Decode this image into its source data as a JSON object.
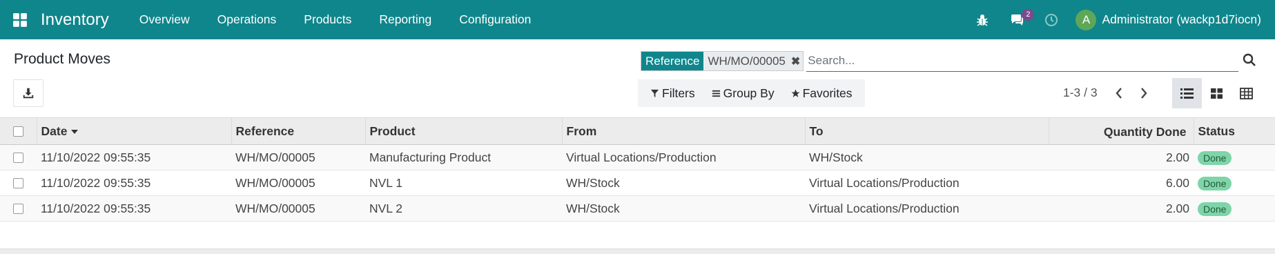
{
  "navbar": {
    "brand": "Inventory",
    "menu": [
      "Overview",
      "Operations",
      "Products",
      "Reporting",
      "Configuration"
    ],
    "icons": [
      "bug-icon",
      "chat-icon",
      "clock-icon"
    ],
    "chat_badge": "2",
    "user_initial": "A",
    "user_name": "Administrator (wackp1d7iocn)",
    "color": "#0f868c"
  },
  "control": {
    "title": "Product Moves",
    "facet_category": "Reference",
    "facet_value": "WH/MO/00005",
    "search_placeholder": "Search...",
    "filters_label": "Filters",
    "groupby_label": "Group By",
    "favorites_label": "Favorites",
    "pager": "1-3 / 3"
  },
  "table": {
    "columns": [
      "Date",
      "Reference",
      "Product",
      "From",
      "To",
      "Quantity Done",
      "Status"
    ],
    "rows": [
      {
        "date": "11/10/2022 09:55:35",
        "reference": "WH/MO/00005",
        "product": "Manufacturing Product",
        "from": "Virtual Locations/Production",
        "to": "WH/Stock",
        "qty": "2.00",
        "status": "Done"
      },
      {
        "date": "11/10/2022 09:55:35",
        "reference": "WH/MO/00005",
        "product": "NVL 1",
        "from": "WH/Stock",
        "to": "Virtual Locations/Production",
        "qty": "6.00",
        "status": "Done"
      },
      {
        "date": "11/10/2022 09:55:35",
        "reference": "WH/MO/00005",
        "product": "NVL 2",
        "from": "WH/Stock",
        "to": "Virtual Locations/Production",
        "qty": "2.00",
        "status": "Done"
      }
    ],
    "status_color": "#7fd4a8"
  }
}
